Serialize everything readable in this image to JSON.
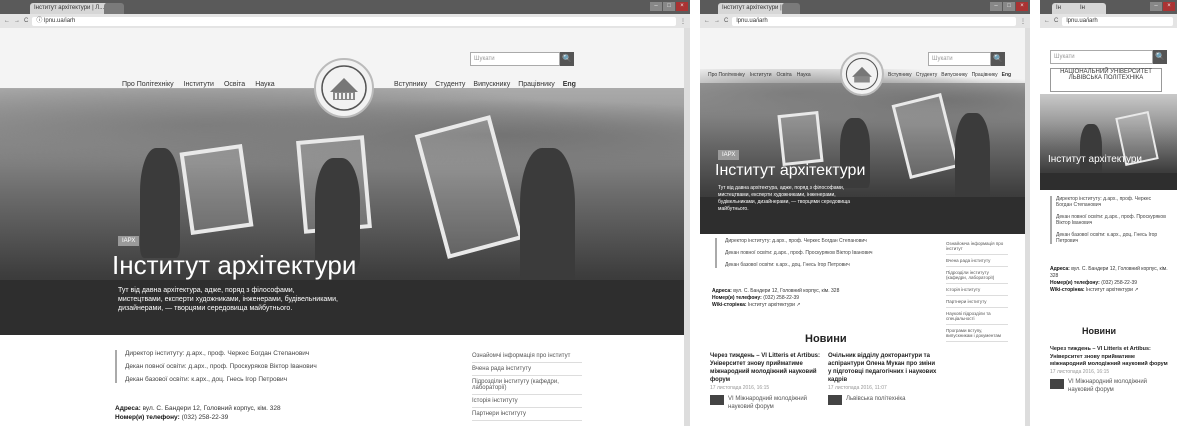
{
  "browser": {
    "tab_label": "Інститут архітектури | Л...",
    "tab_close": "×",
    "short_tab": "Ін",
    "address": "lpnu.ua/iarh",
    "secure_mark": "ⓘ",
    "back": "←",
    "forward": "→",
    "reload": "C",
    "menu": "⋮"
  },
  "site": {
    "nav_left": [
      "Про Політехніку",
      "Інститути",
      "Освіта",
      "Наука"
    ],
    "nav_right": [
      "Вступнику",
      "Студенту",
      "Випускнику",
      "Працівнику"
    ],
    "lang": "Eng",
    "search_placeholder": "Шукати",
    "search_btn": "🔍",
    "badge": "ІАРХ",
    "title": "Інститут архітектури",
    "description": "Тут від давна архітектура, адже, поряд з філософами, мистецтвами, експерти художниками, інженерами, будівельниками, дизайнерами, — творцями середовища майбутнього.",
    "director": "Директор інституту: д.арх., проф. Черкес Богдан Степанович",
    "dean": "Декан повної освіти: д.арх., проф. Проскуряков Віктор Іванович",
    "dean2": "Декан базової освіти: к.арх., доц. Гнесь Ігор Петрович",
    "address_label": "Адреса:",
    "address_value": "вул. С. Бандери 12, Головний корпус, кім. 328",
    "phone_label": "Номер(и) телефону:",
    "phone_value": "(032) 258-22-39",
    "wiki_label": "Wiki-сторінка:",
    "wiki_value": "Інститут архітектури ↗",
    "side_links": [
      "Ознайомчі інформація про інститут",
      "Вчена рада інституту",
      "Підрозділи інституту (кафедри, лабораторії)",
      "Історія інституту",
      "Партнери інституту"
    ],
    "side_links2": [
      "Ознайомча інформація про інститут",
      "Вчена рада інституту",
      "Підрозділи інституту (кафедри, лабораторії)",
      "Історія інституту",
      "Партнери інституту",
      "Наукові підрозділи та спеціальності",
      "Програми вступу, випускникам і документам"
    ],
    "news_heading": "Новини",
    "news1_title": "Через тиждень – VI Litteris et Artibus: Університет знову прийматиме міжнародний молодіжний науковий форум",
    "news1_date": "17 листопада 2016, 16:15",
    "news1_sub": "VI Міжнародний молодіжний науковий форум",
    "news2_title": "Очільник відділу докторантури та аспірантури Олена Мукан про зміни у підготовці педагогічних і наукових кадрів",
    "news2_date": "17 листопада 2016, 11:07",
    "news2_sub": "Львівська політехніка",
    "banner": "НАЦІОНАЛЬНИЙ УНІВЕРСИТЕТ ЛЬВІВСЬКА ПОЛІТЕХНІКА",
    "mobile_title": "Інститут архітектури",
    "mobile_director": "Директор інституту: д.арх., проф. Черкес Богдан Степанович",
    "mobile_dean": "Декан повної освіти: д.арх., проф. Проскуряков Віктор Іванович",
    "mobile_dean2": "Декан базової освіти: к.арх., доц. Гнесь Ігор Петрович",
    "mobile_news1": "Через тиждень – VI Litteris et Artibus: Університет знову прийматиме міжнародний молодіжний науковий форум",
    "mobile_news1_date": "17 листопада 2016, 16:15",
    "mobile_news1_sub": "VI Міжнародний молодіжний науковий форум"
  }
}
